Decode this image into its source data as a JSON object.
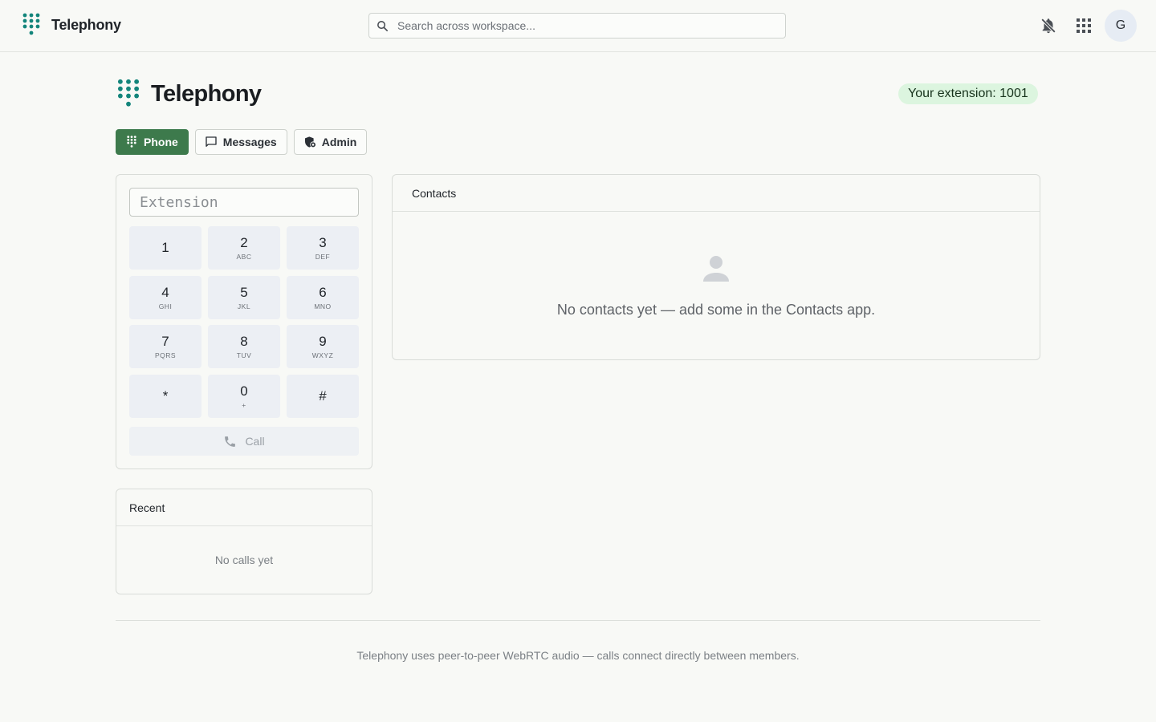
{
  "topbar": {
    "app_name": "Telephony",
    "search_placeholder": "Search across workspace...",
    "avatar_initial": "G",
    "icons": [
      "dialpad-logo-icon",
      "search-icon",
      "bell-off-icon",
      "apps-grid-icon"
    ]
  },
  "header": {
    "title": "Telephony",
    "extension_badge": "Your extension: 1001"
  },
  "tabs": [
    {
      "label": "Phone",
      "icon": "dialpad-icon",
      "active": true
    },
    {
      "label": "Messages",
      "icon": "message-icon",
      "active": false
    },
    {
      "label": "Admin",
      "icon": "admin-shield-icon",
      "active": false
    }
  ],
  "dialer": {
    "input_placeholder": "Extension",
    "keys": [
      {
        "num": "1",
        "sub": ""
      },
      {
        "num": "2",
        "sub": "ABC"
      },
      {
        "num": "3",
        "sub": "DEF"
      },
      {
        "num": "4",
        "sub": "GHI"
      },
      {
        "num": "5",
        "sub": "JKL"
      },
      {
        "num": "6",
        "sub": "MNO"
      },
      {
        "num": "7",
        "sub": "PQRS"
      },
      {
        "num": "8",
        "sub": "TUV"
      },
      {
        "num": "9",
        "sub": "WXYZ"
      },
      {
        "num": "*",
        "sub": ""
      },
      {
        "num": "0",
        "sub": "+"
      },
      {
        "num": "#",
        "sub": ""
      }
    ],
    "call_label": "Call"
  },
  "recent": {
    "title": "Recent",
    "empty": "No calls yet"
  },
  "contacts": {
    "title": "Contacts",
    "empty": "No contacts yet — add some in the Contacts app."
  },
  "footer": {
    "text": "Telephony uses peer-to-peer WebRTC audio — calls connect directly between members."
  },
  "colors": {
    "accent": "#3d7a4c",
    "logo_teal": "#13857b",
    "badge_bg": "#dcf5df",
    "background": "#f8f9f6"
  }
}
